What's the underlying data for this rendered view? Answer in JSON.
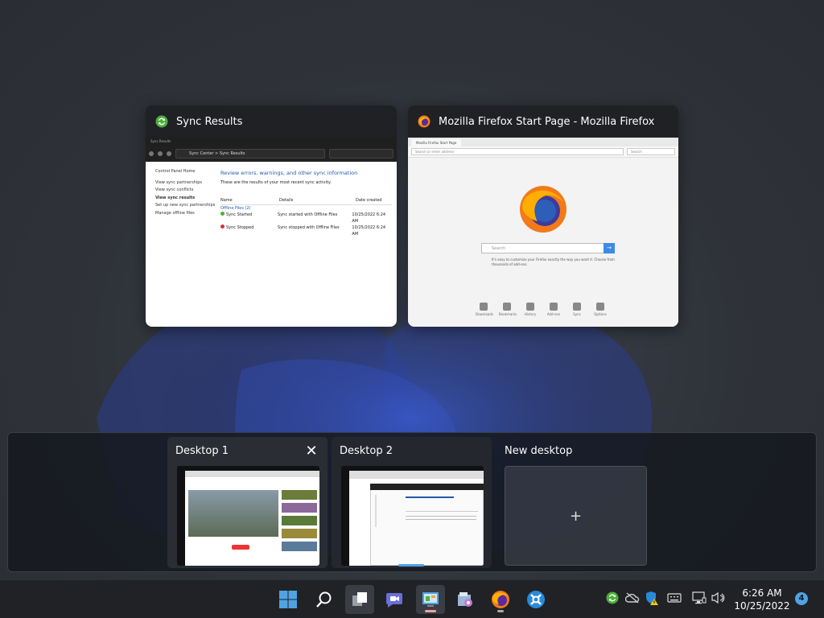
{
  "windows": [
    {
      "title": "Sync Results",
      "icon": "sync-center-icon",
      "content": {
        "window_label": "Sync Results",
        "address": "Sync Center  >  Sync Results",
        "sidebar": [
          "Control Panel Home",
          "View sync partnerships",
          "View sync conflicts",
          "View sync results",
          "Set up new sync partnerships",
          "Manage offline files"
        ],
        "heading": "Review errors, warnings, and other sync information",
        "subheading": "These are the results of your most recent sync activity.",
        "columns": [
          "Name",
          "Details",
          "Date created"
        ],
        "group": "Offline Files (2)",
        "rows": [
          {
            "name": "Sync Started",
            "details": "Sync started with Offline Files",
            "date": "10/25/2022 6:24 AM"
          },
          {
            "name": "Sync Stopped",
            "details": "Sync stopped with Offline Files",
            "date": "10/25/2022 6:24 AM"
          }
        ]
      }
    },
    {
      "title": "Mozilla Firefox Start Page - Mozilla Firefox",
      "icon": "firefox-icon",
      "content": {
        "tab": "Mozilla Firefox Start Page",
        "url": "Search or enter address",
        "search_bar": "Search",
        "search_placeholder": "Search",
        "tip": "It's easy to customize your Firefox exactly the way you want it. Choose from thousands of add-ons.",
        "launcher": [
          "Downloads",
          "Bookmarks",
          "History",
          "Add-ons",
          "Sync",
          "Options"
        ]
      }
    }
  ],
  "desktops": [
    {
      "label": "Desktop 1",
      "close_glyph": "✕"
    },
    {
      "label": "Desktop 2"
    }
  ],
  "new_desktop": {
    "label": "New desktop",
    "glyph": "+"
  },
  "taskbar": {
    "apps": [
      "start-icon",
      "search-icon",
      "task-view-icon",
      "teams-chat-icon",
      "control-panel-icon",
      "tools-icon",
      "firefox-icon",
      "settings-app-icon"
    ],
    "time": "6:26 AM",
    "date": "10/25/2022",
    "notifications": "4"
  },
  "colors": {
    "accent": "#4fa3e3",
    "firefox_orange": "#f27a1a",
    "sync_green": "#4caf3a"
  }
}
